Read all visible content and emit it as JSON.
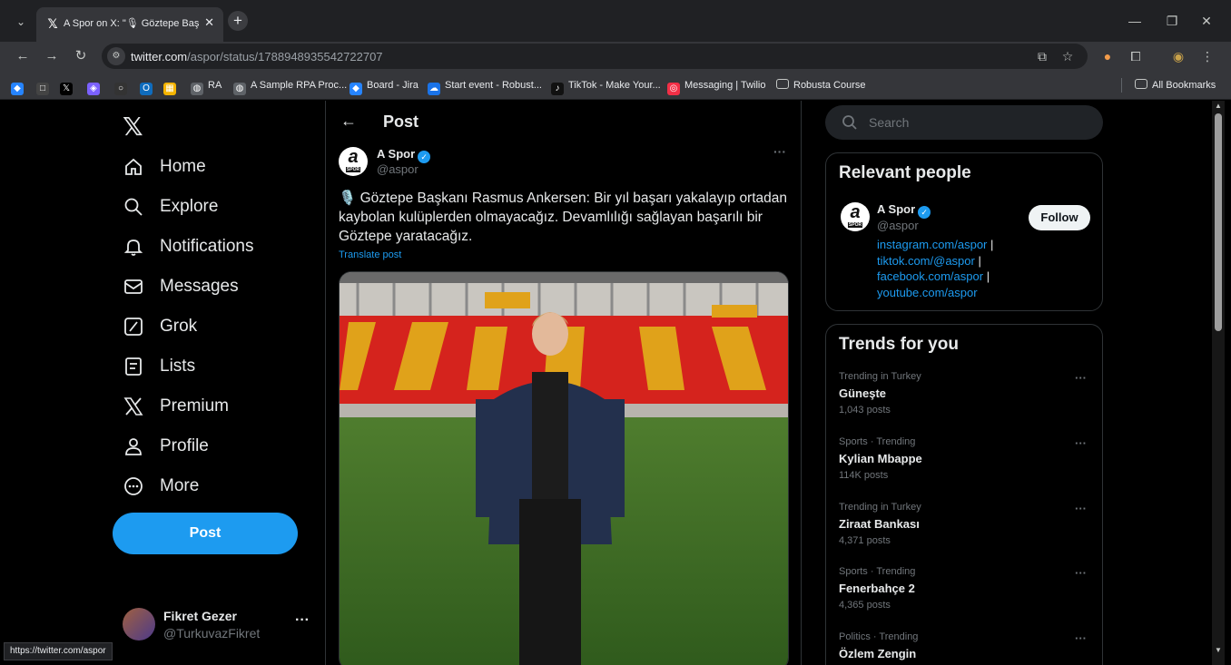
{
  "browser": {
    "tab": {
      "title": "A Spor on X: \"🎙 Göztepe Başka",
      "favicon": "x-logo-icon"
    },
    "url": {
      "domain": "twitter.com",
      "path": "/aspor/status/1788948935542722707"
    },
    "bookmarks": [
      {
        "label": "",
        "icon": "jira-icon",
        "color": "#2684ff"
      },
      {
        "label": "",
        "icon": "square-icon",
        "color": "#444"
      },
      {
        "label": "",
        "icon": "x-icon",
        "color": "#000"
      },
      {
        "label": "",
        "icon": "diamond-icon",
        "color": "#7b61ff"
      },
      {
        "label": "",
        "icon": "circle-icon",
        "color": "#333"
      },
      {
        "label": "",
        "icon": "outlook-icon",
        "color": "#0f6cbd"
      },
      {
        "label": "",
        "icon": "grid-icon",
        "color": "#f4b400"
      },
      {
        "label": "RA",
        "icon": "globe-icon",
        "color": "#5f6368"
      },
      {
        "label": "A Sample RPA Proc...",
        "icon": "globe-icon",
        "color": "#5f6368"
      },
      {
        "label": "Board - Jira",
        "icon": "jira-icon",
        "color": "#2684ff"
      },
      {
        "label": "Start event - Robust...",
        "icon": "cloud-icon",
        "color": "#1a73e8"
      },
      {
        "label": "TikTok - Make Your...",
        "icon": "tiktok-icon",
        "color": "#111"
      },
      {
        "label": "Messaging | Twilio",
        "icon": "twilio-icon",
        "color": "#f22f46"
      },
      {
        "label": "Robusta Course",
        "icon": "folder-icon",
        "color": "transparent"
      }
    ],
    "all_bookmarks": "All Bookmarks",
    "status_url": "https://twitter.com/aspor"
  },
  "nav": {
    "items": [
      {
        "label": "Home",
        "icon": "home-icon"
      },
      {
        "label": "Explore",
        "icon": "search-icon"
      },
      {
        "label": "Notifications",
        "icon": "bell-icon"
      },
      {
        "label": "Messages",
        "icon": "mail-icon"
      },
      {
        "label": "Grok",
        "icon": "grok-icon"
      },
      {
        "label": "Lists",
        "icon": "list-icon"
      },
      {
        "label": "Premium",
        "icon": "x-logo-icon"
      },
      {
        "label": "Profile",
        "icon": "person-icon"
      },
      {
        "label": "More",
        "icon": "more-circle-icon"
      }
    ],
    "post_button": "Post",
    "account": {
      "name": "Fikret Gezer",
      "handle": "@TurkuvazFikret"
    }
  },
  "main": {
    "header_title": "Post",
    "post": {
      "author_name": "A Spor",
      "author_handle": "@aspor",
      "avatar_letter": "a",
      "avatar_sub": "SPOR",
      "text": "🎙️ Göztepe Başkanı Rasmus Ankersen: Bir yıl başarı yakalayıp ortadan kaybolan kulüplerden olmayacağız. Devamlılığı sağlayan başarılı bir Göztepe yaratacağız.",
      "translate": "Translate post"
    }
  },
  "sidebar_right": {
    "search_placeholder": "Search",
    "relevant": {
      "title": "Relevant people",
      "name": "A Spor",
      "handle": "@aspor",
      "follow": "Follow",
      "links": [
        "instagram.com/aspor",
        "tiktok.com/@aspor",
        "facebook.com/aspor",
        "youtube.com/aspor"
      ],
      "separator": "|"
    },
    "trends": {
      "title": "Trends for you",
      "items": [
        {
          "meta": "Trending in Turkey",
          "name": "Güneşte",
          "count": "1,043 posts"
        },
        {
          "meta": "Sports · Trending",
          "name": "Kylian Mbappe",
          "count": "114K posts"
        },
        {
          "meta": "Trending in Turkey",
          "name": "Ziraat Bankası",
          "count": "4,371 posts"
        },
        {
          "meta": "Sports · Trending",
          "name": "Fenerbahçe 2",
          "count": "4,365 posts"
        },
        {
          "meta": "Politics · Trending",
          "name": "Özlem Zengin",
          "count": ""
        }
      ]
    }
  },
  "colors": {
    "accent": "#1d9bf0",
    "background": "#000000",
    "border": "#2f3336",
    "muted": "#71767b"
  }
}
